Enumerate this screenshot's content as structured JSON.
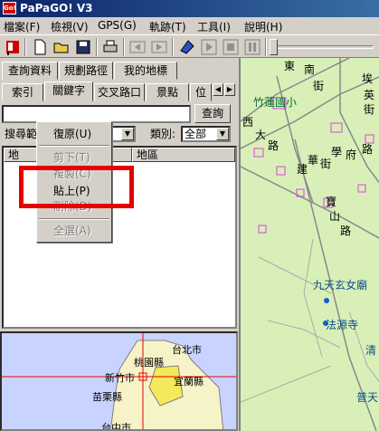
{
  "window": {
    "title": "PaPaGO! V3",
    "icon_text": "Go!"
  },
  "menu": [
    {
      "label": "檔案(F)"
    },
    {
      "label": "檢視(V)"
    },
    {
      "label": "GPS(G)"
    },
    {
      "label": "軌跡(T)"
    },
    {
      "label": "工具(I)"
    },
    {
      "label": "說明(H)"
    }
  ],
  "toolbar": {
    "icons": [
      "flag-icon",
      "new-file-icon",
      "open-folder-icon",
      "save-icon",
      "print-icon",
      "back-icon",
      "forward-icon",
      "gps-device-icon",
      "play-icon",
      "stop-icon",
      "pause-icon"
    ]
  },
  "tabs_row1": [
    {
      "label": "查詢資料"
    },
    {
      "label": "規劃路徑"
    },
    {
      "label": "我的地標"
    }
  ],
  "tabs_row2": [
    {
      "label": "索引"
    },
    {
      "label": "關鍵字"
    },
    {
      "label": "交叉路口"
    },
    {
      "label": "景點"
    },
    {
      "label": "位"
    }
  ],
  "search": {
    "input_value": "",
    "button_label": "查詢",
    "scope_label": "搜尋範",
    "category_label": "類別:",
    "category_value": "全部"
  },
  "list": {
    "columns": [
      "地",
      "地區"
    ]
  },
  "context_menu": {
    "items": [
      {
        "label": "復原(U)",
        "disabled": false
      },
      {
        "label": "剪下(T)",
        "disabled": true
      },
      {
        "label": "複製(C)",
        "disabled": true
      },
      {
        "label": "貼上(P)",
        "disabled": false
      },
      {
        "label": "刪除(D)",
        "disabled": true
      },
      {
        "label": "全選(A)",
        "disabled": true
      }
    ]
  },
  "minimap": {
    "labels": [
      "台北市",
      "桃園縣",
      "新竹市",
      "宜蘭縣",
      "苗栗縣",
      "台中市"
    ]
  },
  "map": {
    "labels": [
      "東",
      "南",
      "街",
      "竹蓮國小",
      "埃",
      "英",
      "街",
      "西",
      "大",
      "路",
      "學",
      "府",
      "路",
      "華",
      "建",
      "街",
      "寶",
      "山",
      "路",
      "九天玄女廟",
      "法源寺",
      "清",
      "普天"
    ]
  },
  "colors": {
    "highlight": "#e60000",
    "titlebar": "#0a246a",
    "map_bg": "#d8f0b8",
    "road_purple": "#e040e0"
  }
}
